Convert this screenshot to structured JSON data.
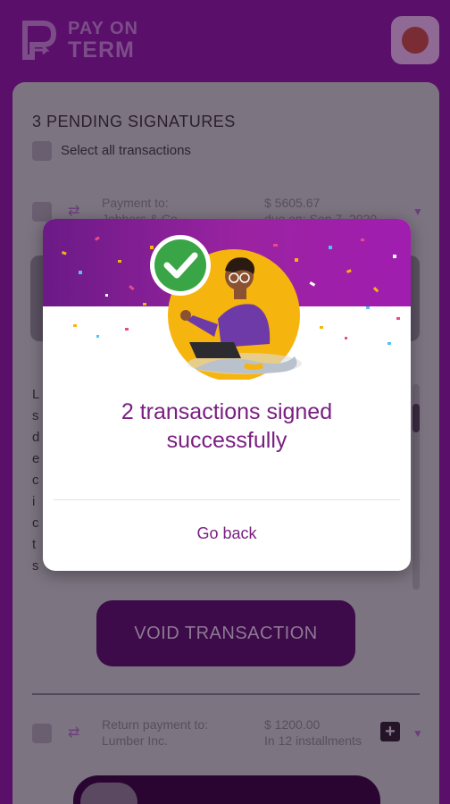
{
  "app": {
    "brand_line1": "PAY ON",
    "brand_line2": "TERM"
  },
  "list": {
    "title": "3 PENDING SIGNATURES",
    "select_all_label": "Select all transactions",
    "transactions": [
      {
        "payee_label": "Payment to:",
        "payee_name": "Jobbers & Co.",
        "amount": "$ 5605.67",
        "due": "due on: Sep 7, 2020"
      },
      {
        "payee_label": "Return payment to:",
        "payee_name": "Lumber Inc.",
        "amount": "$ 1200.00",
        "due": "In 12 installments"
      }
    ],
    "void_button": "VOID TRANSACTION"
  },
  "modal": {
    "message": "2 transactions signed successfully",
    "go_back_label": "Go back"
  },
  "colors": {
    "brand_purple": "#7a1f82",
    "banner_start": "#6b1a86",
    "banner_end": "#a11db0",
    "success_green": "#3aa546",
    "illustration_sun": "#f6b40e"
  },
  "icons": [
    "brand-logo-icon",
    "fox-avatar-icon",
    "transfer-arrows-icon",
    "chevron-down-icon",
    "plus-icon",
    "checkmark-icon"
  ]
}
